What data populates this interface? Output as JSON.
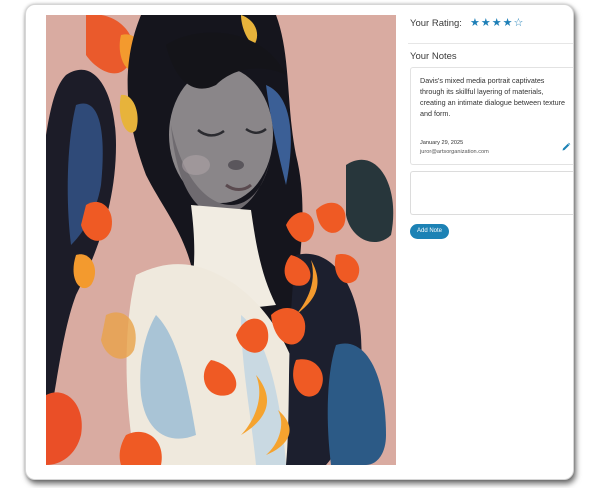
{
  "rating": {
    "label": "Your Rating:",
    "value": 4,
    "max": 5,
    "filled_star": "★",
    "empty_star": "☆"
  },
  "notes": {
    "heading": "Your Notes",
    "entries": [
      {
        "text": "Davis's mixed media portrait captivates through its skillful layering of materials, creating an intimate dialogue between texture and form.",
        "date": "January 29, 2025",
        "author": "juror@artsorganization.com"
      }
    ],
    "input_value": "",
    "add_button_label": "Add Note"
  },
  "colors": {
    "accent": "#1c82b5",
    "artwork_background": "#d8aaa0"
  },
  "icons": {
    "edit": "pencil-icon",
    "star": "star-icon"
  }
}
